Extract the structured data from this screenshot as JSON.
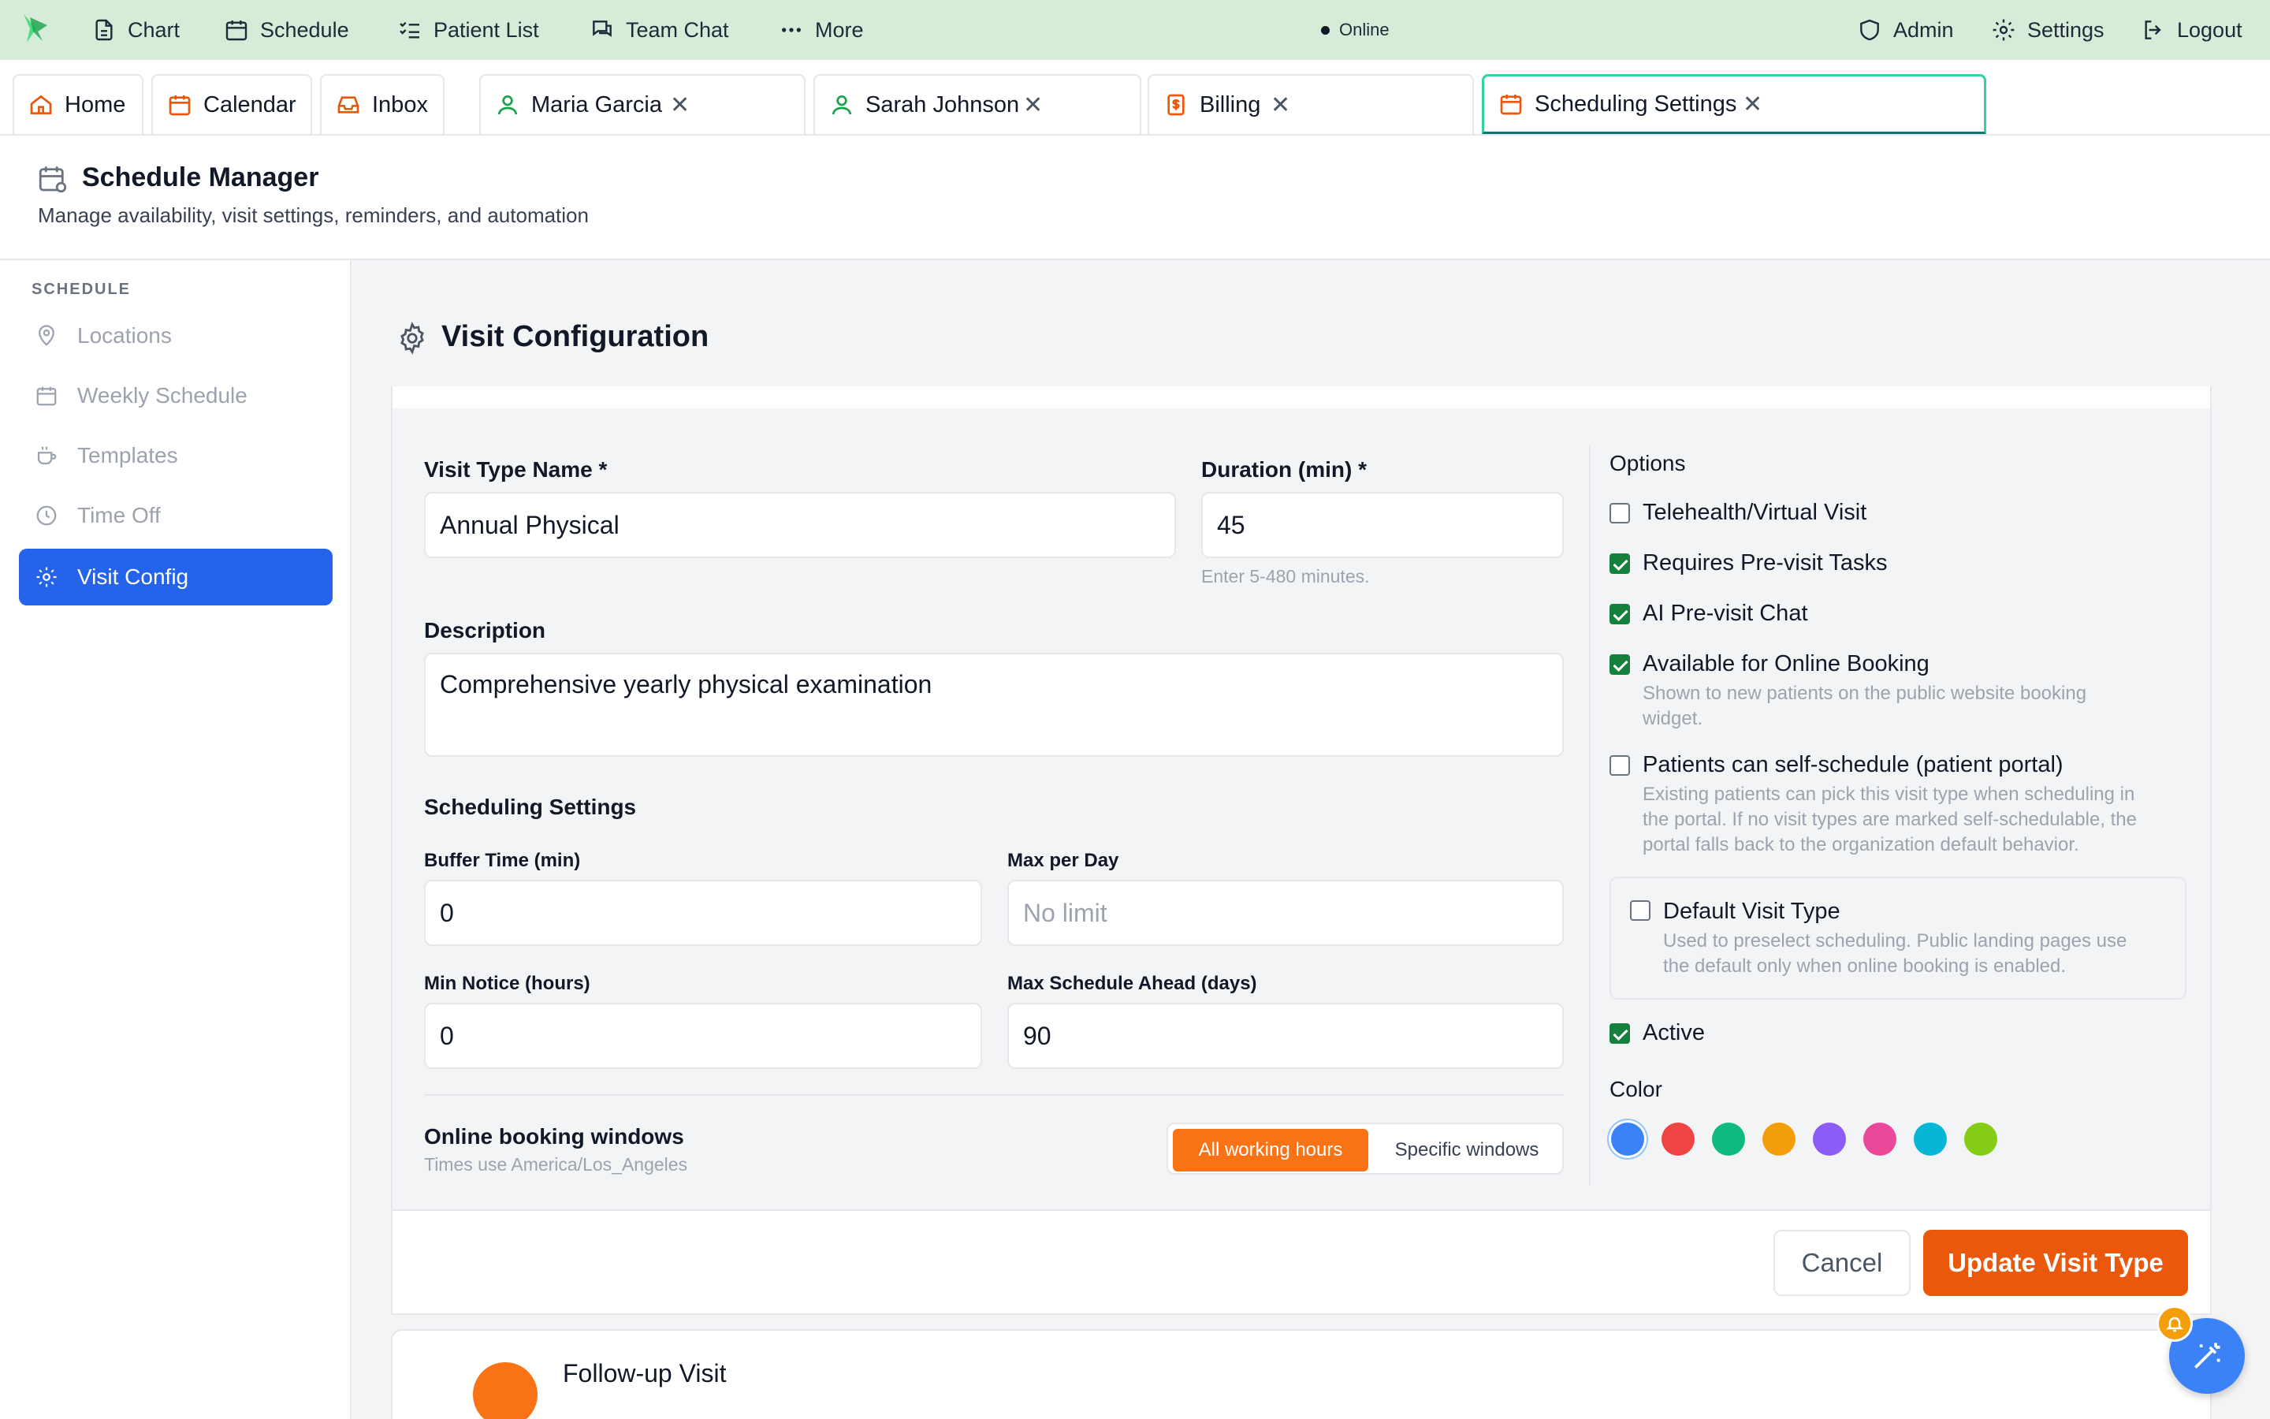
{
  "topnav": {
    "items": [
      {
        "label": "Chart",
        "icon": "document-icon"
      },
      {
        "label": "Schedule",
        "icon": "calendar-icon"
      },
      {
        "label": "Patient List",
        "icon": "list-check-icon"
      },
      {
        "label": "Team Chat",
        "icon": "chat-icon"
      },
      {
        "label": "More",
        "icon": "ellipsis-icon"
      }
    ],
    "status": "Online",
    "right": [
      {
        "label": "Admin",
        "icon": "shield-icon"
      },
      {
        "label": "Settings",
        "icon": "gear-icon"
      },
      {
        "label": "Logout",
        "icon": "logout-icon"
      }
    ],
    "bg_color": "#d6ecd9"
  },
  "tabs": {
    "fixed": [
      {
        "label": "Home",
        "icon": "home-icon"
      },
      {
        "label": "Calendar",
        "icon": "calendar-icon"
      },
      {
        "label": "Inbox",
        "icon": "inbox-icon"
      }
    ],
    "open": [
      {
        "label": "Maria Garcia",
        "icon": "user-icon"
      },
      {
        "label": "Sarah Johnson",
        "icon": "user-icon"
      },
      {
        "label": "Billing",
        "icon": "billing-icon"
      },
      {
        "label": "Scheduling Settings",
        "icon": "calendar-icon",
        "active": true
      }
    ],
    "close_glyph": "✕"
  },
  "header": {
    "title": "Schedule Manager",
    "subtitle": "Manage availability, visit settings, reminders, and automation"
  },
  "sidebar": {
    "section": "SCHEDULE",
    "items": [
      {
        "label": "Locations",
        "icon": "map-pin-icon"
      },
      {
        "label": "Weekly Schedule",
        "icon": "calendar-icon"
      },
      {
        "label": "Templates",
        "icon": "coffee-icon"
      },
      {
        "label": "Time Off",
        "icon": "clock-icon"
      },
      {
        "label": "Visit Config",
        "icon": "gear-icon",
        "active": true
      }
    ],
    "active_color": "#2563eb"
  },
  "main": {
    "title": "Visit Configuration",
    "form": {
      "name_label": "Visit Type Name *",
      "name_value": "Annual Physical",
      "duration_label": "Duration (min) *",
      "duration_value": "45",
      "duration_hint": "Enter 5-480 minutes.",
      "description_label": "Description",
      "description_value": "Comprehensive yearly physical examination",
      "scheduling_heading": "Scheduling Settings",
      "buffer_label": "Buffer Time (min)",
      "buffer_value": "0",
      "maxday_label": "Max per Day",
      "maxday_placeholder": "No limit",
      "notice_label": "Min Notice (hours)",
      "notice_value": "0",
      "ahead_label": "Max Schedule Ahead (days)",
      "ahead_value": "90",
      "windows_label": "Online booking windows",
      "windows_tz": "Times use America/Los_Angeles",
      "windows_options": [
        "All working hours",
        "Specific windows"
      ],
      "windows_selected": "All working hours"
    },
    "options": {
      "heading": "Options",
      "items": [
        {
          "label": "Telehealth/Virtual Visit",
          "checked": false
        },
        {
          "label": "Requires Pre-visit Tasks",
          "checked": true
        },
        {
          "label": "AI Pre-visit Chat",
          "checked": true
        },
        {
          "label": "Available for Online Booking",
          "checked": true,
          "desc": [
            "Shown to new patients on the public website booking",
            "widget."
          ]
        },
        {
          "label": "Patients can self-schedule (patient portal)",
          "checked": false,
          "desc": [
            "Existing patients can pick this visit type when scheduling in",
            "the portal. If no visit types are marked self-schedulable, the",
            "portal falls back to the organization default behavior."
          ]
        }
      ],
      "default_type": {
        "label": "Default Visit Type",
        "checked": false,
        "desc": [
          "Used to preselect scheduling. Public landing pages use",
          "the default only when online booking is enabled."
        ]
      },
      "active": {
        "label": "Active",
        "checked": true
      },
      "color_label": "Color",
      "colors": [
        "#3b82f6",
        "#ef4444",
        "#10b981",
        "#f59e0b",
        "#8b5cf6",
        "#ec4899",
        "#06b6d4",
        "#84cc16"
      ],
      "selected_color": "#3b82f6"
    },
    "buttons": {
      "cancel": "Cancel",
      "update": "Update Visit Type"
    },
    "next_item": {
      "title": "Follow-up Visit"
    }
  }
}
